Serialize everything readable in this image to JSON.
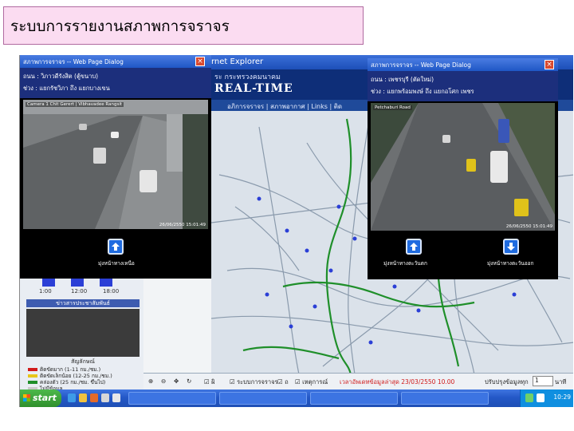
{
  "slide": {
    "title": "ระบบการรายงานสภาพการจราจร"
  },
  "background_window": {
    "title_visible": "rnet Explorer",
    "header_line1": "ระ กระทรวงคมนาคม",
    "header_line2": "REAL-TIME",
    "nav_text": "อภิการจราจร | สภาพอากาศ | Links | ติด"
  },
  "left_panel": {
    "times": [
      "1:00",
      "12:00",
      "18:00"
    ],
    "strip_label": "ข่าวสารประชาสัมพันธ์",
    "legend_title": "สัญลักษณ์",
    "legend": [
      {
        "label": "ติดขัดมาก (1-11 กม./ชม.)",
        "color": "#d11a1a"
      },
      {
        "label": "ติดขัดเล็กน้อย (12-25 กม./ชม.)",
        "color": "#e8c51a"
      },
      {
        "label": "คล่องตัว (25 กม./ชม. ขึ้นไป)",
        "color": "#1f8f2a"
      },
      {
        "label": "ไม่มีข้อมูล",
        "color": "#c9c9c9"
      }
    ]
  },
  "map_bottom": {
    "items": [
      "ผิ",
      "ระบบการจราจร",
      "ถ",
      "เหตุการณ์"
    ],
    "updated": "เวลาอัพเดทข้อมูลล่าสุด 23/03/2550 10.00",
    "refresh_label": "ปรับปรุงข้อมูลทุก",
    "refresh_value": "1",
    "refresh_unit": "นาที"
  },
  "dialog_left": {
    "title": "สภาพการจราจร -- Web Page Dialog",
    "line1": "ถนน : วิภาวดีรังสิต (ตู้ขนาบ)",
    "line2": "ช่วง : แยกรัชวิภา ถึง แยกบางเขน",
    "cam_label": "Camera 1 Chit Gerert | Vibhavadee Rangsit",
    "cam_time": "26/06/2550 15:01:49",
    "button_up_label": "มุ่งหน้าทางเหนือ"
  },
  "dialog_right": {
    "title": "สภาพการจราจร -- Web Page Dialog",
    "line1": "ถนน : เพชรบุรี (ตัดใหม่)",
    "line2": "ช่วง : แยกพร้อมพงษ์ ถึง แยกอโศก เพชร",
    "cam_label": "Petchaburi Road",
    "cam_time": "26/06/2550 15:01:49",
    "button_up_label": "มุ่งหน้าทางตะวันตก",
    "button_down_label": "มุ่งหน้าทางตะวันออก"
  },
  "taskbar": {
    "start_label": "start",
    "clock": "10:29"
  }
}
